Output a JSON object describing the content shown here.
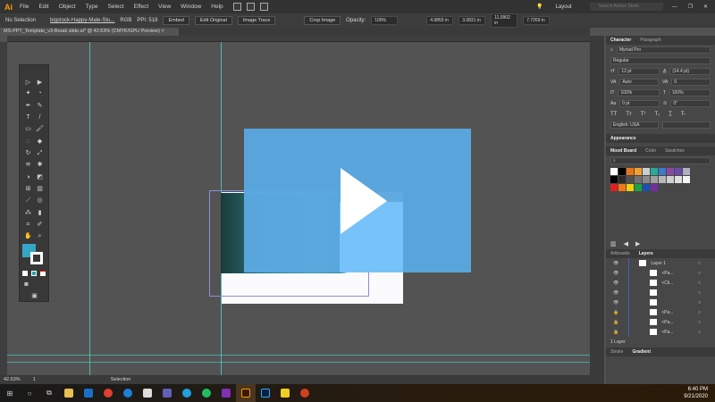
{
  "app": {
    "logo": "Ai",
    "menu": [
      "File",
      "Edit",
      "Object",
      "Type",
      "Select",
      "Effect",
      "View",
      "Window",
      "Help"
    ],
    "workspace": "Layout",
    "search_placeholder": "Search Adobe Stock"
  },
  "control": {
    "selection": "No Selection",
    "filename": "bigstock-Happy-Male-Stu...",
    "color_mode": "RGB",
    "ppi": "PPI: 518",
    "embed": "Embed",
    "edit_original": "Edit Original",
    "image_trace": "Image Trace",
    "crop_image": "Crop Image",
    "opacity_label": "Opacity:",
    "opacity_value": "100%",
    "x": "4.9855 in",
    "y": "3.0831 in",
    "w": "11.0902 in",
    "h": "7.7269 in"
  },
  "document_tab": {
    "title": "MS-PPT_Template_v3-Break slide.ai* @ 42.63% (CMYK/GPU Preview)",
    "close": "×"
  },
  "status": {
    "zoom": "42.63%",
    "artboard": "1",
    "tool": "Selection"
  },
  "character": {
    "tabs": [
      "Character",
      "Paragraph"
    ],
    "font": "Myriad Pro",
    "style": "Regular",
    "size": "12 pt",
    "leading": "(14.4 pt)",
    "kerning": "Auto",
    "tracking": "0",
    "vscale": "100%",
    "hscale": "100%",
    "baseline": "0 pt",
    "rotation": "0°",
    "language": "English: USA"
  },
  "appearance": {
    "title": "Appearance"
  },
  "swatches": {
    "tabs": [
      "Mood Board",
      "Color",
      "Swatches"
    ],
    "row1": [
      "#ffffff",
      "#000000",
      "#e8731a",
      "#f0a030",
      "#c8d0d0",
      "#2aa89a",
      "#3a7ac8",
      "#8a4aa0",
      "#6a4aa8",
      "#b0b0c0"
    ],
    "row2": [
      "#000000",
      "#2a2a2a",
      "#505050",
      "#707070",
      "#888888",
      "#a0a0a0",
      "#b8b8b8",
      "#d0d0d0",
      "#e0e0e0",
      "#f5f5f5"
    ],
    "row3": [
      "#e02020",
      "#f07818",
      "#f0d010",
      "#20a040",
      "#1a50b0",
      "#7030a0"
    ]
  },
  "layers": {
    "tabs": [
      "Artboards",
      "Layers"
    ],
    "items": [
      "Layer 1",
      "<Pa...",
      "<Cli...",
      "",
      "",
      "<Pa...",
      "<Pa...",
      "<Pa..."
    ],
    "count": "1 Layer"
  },
  "bottom_tabs": [
    "Stroke",
    "Gradient"
  ],
  "taskbar": {
    "time": "6:40 PM",
    "date": "9/21/2020"
  },
  "colors": {
    "video_overlay": "#5aa8e0",
    "accent_guide": "#4fb8b0",
    "illustrator": "#ff9a00"
  }
}
